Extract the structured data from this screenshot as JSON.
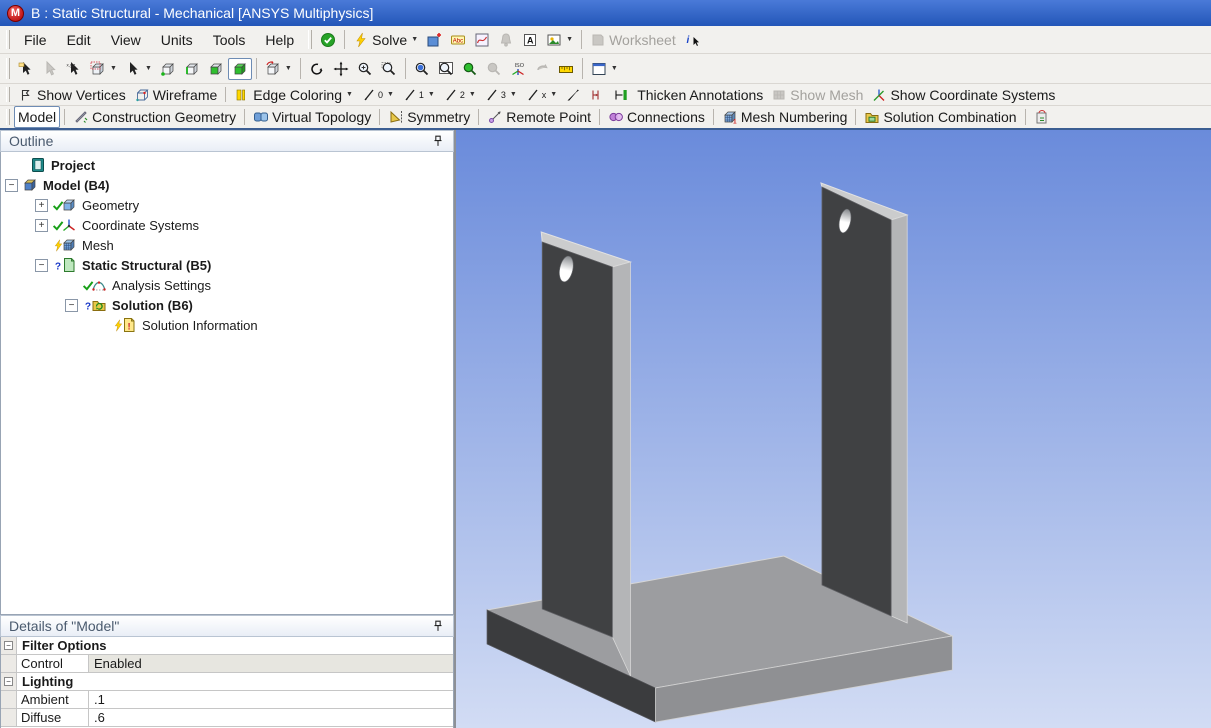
{
  "title_bar": {
    "title": "B : Static Structural - Mechanical [ANSYS Multiphysics]"
  },
  "menus": [
    "File",
    "Edit",
    "View",
    "Units",
    "Tools",
    "Help"
  ],
  "quick_toolbar": [
    {
      "type": "grip"
    },
    {
      "type": "btn",
      "name": "status-ok-button",
      "icon": "check-circle"
    },
    {
      "type": "sep"
    },
    {
      "type": "btn",
      "name": "solve-button",
      "icon": "lightning",
      "label": "Solve",
      "dropdown": true
    },
    {
      "type": "btn",
      "name": "new-chart-button",
      "icon": "chart-add"
    },
    {
      "type": "btn",
      "name": "annotation-button",
      "icon": "abc-tag"
    },
    {
      "type": "btn",
      "name": "chart-button",
      "icon": "graph"
    },
    {
      "type": "btn",
      "name": "alert-button",
      "icon": "bell",
      "disabled": true
    },
    {
      "type": "btn",
      "name": "text-label-button",
      "icon": "letter-a"
    },
    {
      "type": "btn",
      "name": "image-capture-button",
      "icon": "image",
      "dropdown": true
    },
    {
      "type": "sep"
    },
    {
      "type": "btn",
      "name": "worksheet-button",
      "icon": "worksheet",
      "label": "Worksheet",
      "disabled": true
    },
    {
      "type": "btn",
      "name": "selection-information-button",
      "icon": "info-cursor"
    }
  ],
  "select_toolbar": [
    {
      "type": "grip"
    },
    {
      "type": "btn",
      "name": "label-select-button",
      "icon": "cursor-label"
    },
    {
      "type": "btn",
      "name": "direction-select-button",
      "icon": "cursor-gray",
      "disabled": true
    },
    {
      "type": "btn",
      "name": "coordinates-select-button",
      "icon": "cursor-xyz"
    },
    {
      "type": "btn",
      "name": "select-mode-button",
      "icon": "box-select",
      "dropdown": true
    },
    {
      "type": "btn",
      "name": "select-type-button",
      "icon": "cursor-plain",
      "dropdown": true
    },
    {
      "type": "btn",
      "name": "vertex-select-button",
      "icon": "cube-vertex"
    },
    {
      "type": "btn",
      "name": "edge-select-button",
      "icon": "cube-edge"
    },
    {
      "type": "btn",
      "name": "face-select-button",
      "icon": "cube-face"
    },
    {
      "type": "btn",
      "name": "body-select-button",
      "icon": "cube-body",
      "pressed": true
    },
    {
      "type": "sep"
    },
    {
      "type": "btn",
      "name": "extend-selection-button",
      "icon": "cube-extend",
      "dropdown": true
    },
    {
      "type": "sep"
    },
    {
      "type": "btn",
      "name": "rotate-button",
      "icon": "rotate"
    },
    {
      "type": "btn",
      "name": "pan-button",
      "icon": "pan"
    },
    {
      "type": "btn",
      "name": "zoom-button",
      "icon": "zoom"
    },
    {
      "type": "btn",
      "name": "box-zoom-button",
      "icon": "zoom-box"
    },
    {
      "type": "sep"
    },
    {
      "type": "btn",
      "name": "zoom-to-fit-button",
      "icon": "fit"
    },
    {
      "type": "btn",
      "name": "magnifier-window-button",
      "icon": "zoom-window"
    },
    {
      "type": "btn",
      "name": "zoom-in-button",
      "icon": "mag-green"
    },
    {
      "type": "btn",
      "name": "zoom-out-button",
      "icon": "mag-gray",
      "disabled": true
    },
    {
      "type": "btn",
      "name": "iso-view-button",
      "icon": "iso"
    },
    {
      "type": "btn",
      "name": "previous-view-button",
      "icon": "prev-gray",
      "disabled": true
    },
    {
      "type": "btn",
      "name": "ruler-button",
      "icon": "ruler"
    },
    {
      "type": "sep"
    },
    {
      "type": "btn",
      "name": "viewports-button",
      "icon": "viewports",
      "dropdown": true
    }
  ],
  "graphics_toolbar": [
    {
      "type": "grip"
    },
    {
      "type": "btn",
      "name": "show-vertices-button",
      "icon": "show-vertices",
      "label": "Show Vertices"
    },
    {
      "type": "btn",
      "name": "wireframe-button",
      "icon": "wireframe",
      "label": "Wireframe"
    },
    {
      "type": "sep"
    },
    {
      "type": "btn",
      "name": "edge-coloring-button",
      "icon": "edge-coloring",
      "label": "Edge Coloring",
      "dropdown": true
    },
    {
      "type": "btn",
      "name": "edge-direction-0-button",
      "icon": "pen",
      "sub": "0",
      "dropdown": true
    },
    {
      "type": "btn",
      "name": "edge-direction-1-button",
      "icon": "pen",
      "sub": "1",
      "dropdown": true
    },
    {
      "type": "btn",
      "name": "edge-direction-2-button",
      "icon": "pen",
      "sub": "2",
      "dropdown": true
    },
    {
      "type": "btn",
      "name": "edge-direction-3-button",
      "icon": "pen",
      "sub": "3",
      "dropdown": true
    },
    {
      "type": "btn",
      "name": "edge-direction-x-button",
      "icon": "pen",
      "sub": "x",
      "dropdown": true
    },
    {
      "type": "btn",
      "name": "edge-direction-button",
      "icon": "pen-black"
    },
    {
      "type": "btn",
      "name": "thickness-1-button",
      "icon": "thicken-1"
    },
    {
      "type": "btn",
      "name": "thickness-2-button",
      "icon": "thicken-2"
    },
    {
      "type": "btn",
      "name": "thicken-annotations-button",
      "label": "Thicken Annotations"
    },
    {
      "type": "btn",
      "name": "show-mesh-button",
      "icon": "show-mesh",
      "label": "Show Mesh",
      "disabled": true
    },
    {
      "type": "btn",
      "name": "show-coordinate-systems-button",
      "icon": "coord-axes-x",
      "label": "Show Coordinate Systems"
    }
  ],
  "context_toolbar": [
    {
      "type": "grip"
    },
    {
      "type": "btn",
      "name": "model-tab-button",
      "label": "Model",
      "pressed": true
    },
    {
      "type": "sep"
    },
    {
      "type": "btn",
      "name": "construction-geometry-button",
      "icon": "construction-geometry",
      "label": "Construction Geometry"
    },
    {
      "type": "sep"
    },
    {
      "type": "btn",
      "name": "virtual-topology-button",
      "icon": "virtual-topology",
      "label": "Virtual Topology"
    },
    {
      "type": "sep"
    },
    {
      "type": "btn",
      "name": "symmetry-button",
      "icon": "symmetry",
      "label": "Symmetry"
    },
    {
      "type": "sep"
    },
    {
      "type": "btn",
      "name": "remote-point-button",
      "icon": "remote-point",
      "label": "Remote Point"
    },
    {
      "type": "sep"
    },
    {
      "type": "btn",
      "name": "connections-button",
      "icon": "connections",
      "label": "Connections"
    },
    {
      "type": "sep"
    },
    {
      "type": "btn",
      "name": "mesh-numbering-button",
      "icon": "mesh-numbering",
      "label": "Mesh Numbering"
    },
    {
      "type": "sep"
    },
    {
      "type": "btn",
      "name": "solution-combination-button",
      "icon": "solution-combination",
      "label": "Solution Combination"
    },
    {
      "type": "sep"
    },
    {
      "type": "btn",
      "name": "named-selection-button",
      "icon": "partial-tool"
    }
  ],
  "outline": {
    "header": "Outline",
    "tree": [
      {
        "label": "Project",
        "icon": "project",
        "bold": true,
        "pad": 12,
        "exp": null,
        "status": null
      },
      {
        "label": "Model (B4)",
        "icon": "model",
        "bold": true,
        "pad": 4,
        "exp": "minus",
        "status": null
      },
      {
        "label": "Geometry",
        "icon": "geometry",
        "bold": false,
        "pad": 34,
        "exp": "plus",
        "status": "check"
      },
      {
        "label": "Coordinate Systems",
        "icon": "coordsys",
        "bold": false,
        "pad": 34,
        "exp": "plus",
        "status": "check"
      },
      {
        "label": "Mesh",
        "icon": "mesh",
        "bold": false,
        "pad": 34,
        "exp": null,
        "status": "lightning"
      },
      {
        "label": "Static Structural (B5)",
        "icon": "static",
        "bold": true,
        "pad": 34,
        "exp": "minus",
        "status": "question"
      },
      {
        "label": "Analysis Settings",
        "icon": "analysis",
        "bold": false,
        "pad": 64,
        "exp": null,
        "status": "check"
      },
      {
        "label": "Solution (B6)",
        "icon": "solution",
        "bold": true,
        "pad": 64,
        "exp": "minus",
        "status": "question"
      },
      {
        "label": "Solution Information",
        "icon": "solinfo",
        "bold": false,
        "pad": 94,
        "exp": null,
        "status": "lightning"
      }
    ]
  },
  "details": {
    "header": "Details of \"Model\"",
    "rows": [
      {
        "type": "group",
        "label": "Filter Options"
      },
      {
        "type": "kv",
        "key": "Control",
        "value": "Enabled",
        "shaded": true
      },
      {
        "type": "group",
        "label": "Lighting"
      },
      {
        "type": "kv",
        "key": "Ambient",
        "value": ".1",
        "shaded": false
      },
      {
        "type": "kv",
        "key": "Diffuse",
        "value": ".6",
        "shaded": false
      }
    ]
  },
  "viewport": {
    "bg_top": "#6a8bdb",
    "bg_bottom": "#d2dcf4",
    "base_top": "#9c9da0",
    "base_side": "#8f9093",
    "base_dark": "#3b3c3e",
    "plate_face": "#404143",
    "plate_side": "#b4b5b7",
    "plate_top": "#cbcccd"
  }
}
